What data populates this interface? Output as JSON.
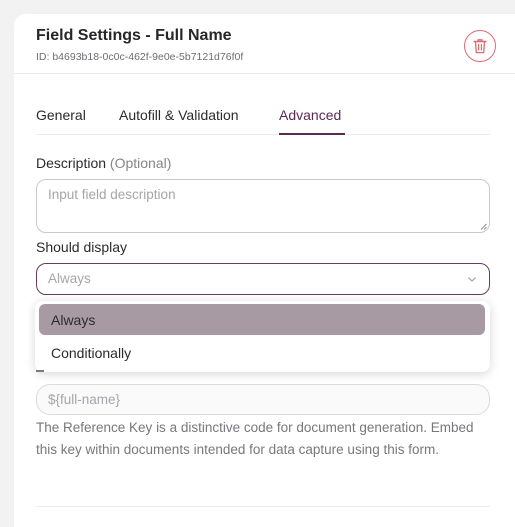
{
  "header": {
    "title": "Field Settings - Full Name",
    "id_text": "ID: b4693b18-0c0c-462f-9e0e-5b7121d76f0f",
    "delete_icon": "trash-icon"
  },
  "tabs": [
    {
      "label": "General",
      "active": false
    },
    {
      "label": "Autofill & Validation",
      "active": false
    },
    {
      "label": "Advanced",
      "active": true
    }
  ],
  "description": {
    "label": "Description",
    "optional": "(Optional)",
    "placeholder": "Input field description"
  },
  "should_display": {
    "label": "Should display",
    "value": "Always",
    "options": [
      "Always",
      "Conditionally"
    ],
    "selected": "Always"
  },
  "reference_key": {
    "value": "${full-name}",
    "help": "The Reference Key is a distinctive code for document generation. Embed this key within documents intended for data capture using this form."
  },
  "colors": {
    "accent": "#5a2a52",
    "delete": "#e06a6e",
    "selected_option_bg": "#a89aa2"
  }
}
